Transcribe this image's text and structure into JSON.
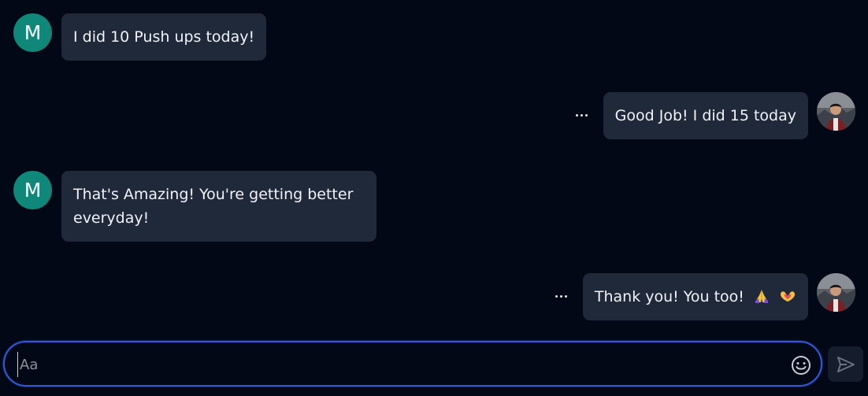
{
  "messages": [
    {
      "side": "left",
      "avatar_letter": "M",
      "text": "I did 10 Push ups today!"
    },
    {
      "side": "right",
      "text": "Good Job! I did 15 today",
      "menu": "more-options"
    },
    {
      "side": "left",
      "avatar_letter": "M",
      "text": "That's Amazing! You're getting better everyday!"
    },
    {
      "side": "right",
      "text": "Thank you! You too!",
      "emojis": [
        "folded-hands-emoji",
        "heart-hands-emoji"
      ],
      "menu": "more-options"
    }
  ],
  "composer": {
    "placeholder": "Aa",
    "value": "",
    "emoji_button": "smile-icon",
    "send_button": "send-icon"
  },
  "colors": {
    "background": "#030817",
    "bubble": "#1f293a",
    "avatar_m": "#0f8779",
    "input_border": "#2f58d4",
    "send_bg": "#151d2c"
  }
}
